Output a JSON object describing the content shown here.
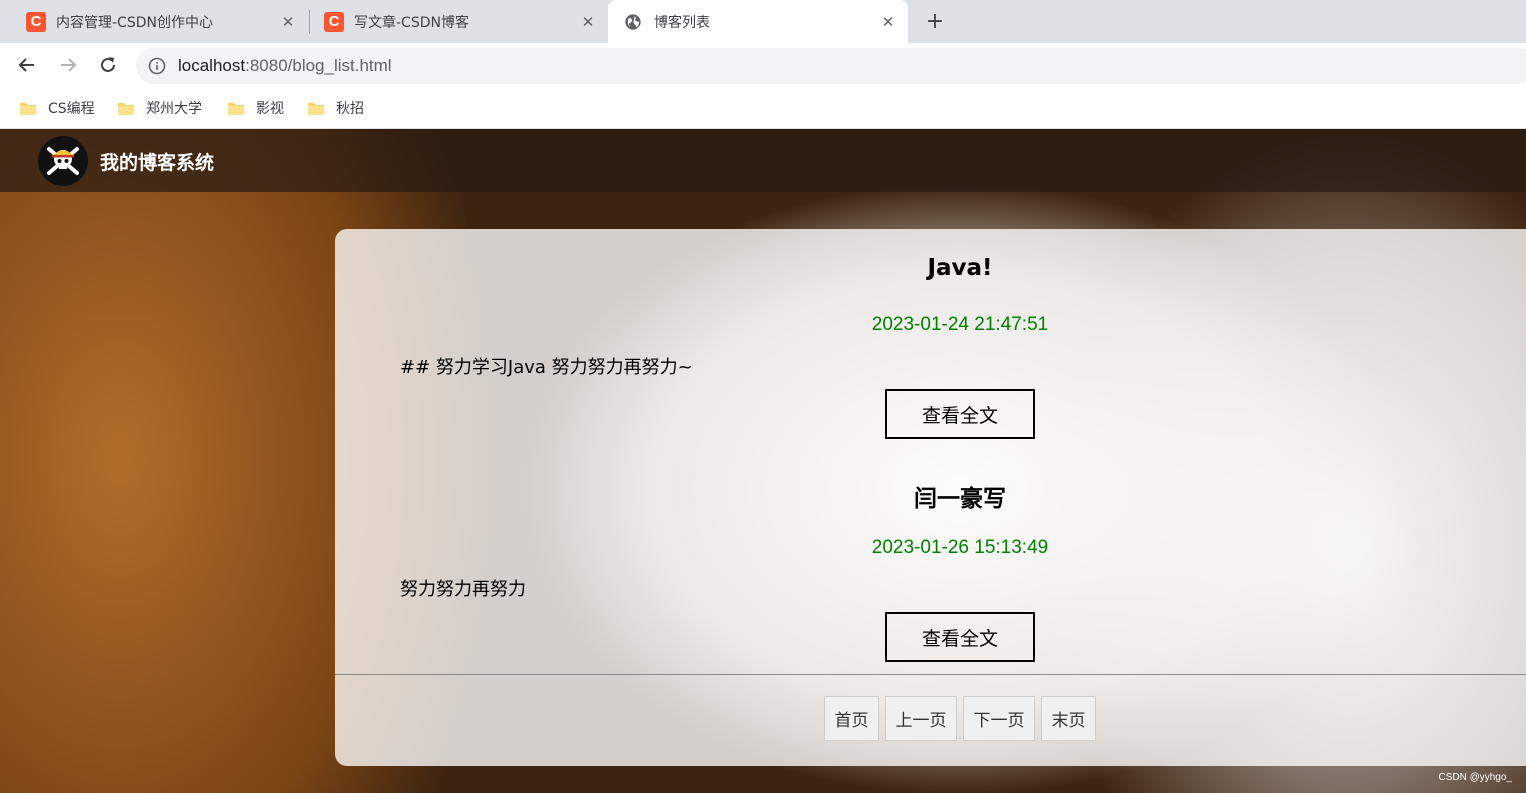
{
  "browser": {
    "tabs": [
      {
        "title": "内容管理-CSDN创作中心",
        "favicon": "csdn-favicon",
        "favicon_letter": "C"
      },
      {
        "title": "写文章-CSDN博客",
        "favicon": "csdn-favicon",
        "favicon_letter": "C"
      },
      {
        "title": "博客列表",
        "favicon": "globe-icon",
        "active": true
      }
    ],
    "url_host": "localhost",
    "url_rest": ":8080/blog_list.html",
    "bookmarks": [
      {
        "label": "CS编程"
      },
      {
        "label": "郑州大学"
      },
      {
        "label": "影视"
      },
      {
        "label": "秋招"
      }
    ]
  },
  "nav": {
    "title": "我的博客系统",
    "logo_icon": "skull-crossbones-icon"
  },
  "blogs": [
    {
      "title": "Java!",
      "date": "2023-01-24 21:47:51",
      "desc": "## 努力学习Java 努力努力再努力~",
      "button": "查看全文"
    },
    {
      "title": "闫一豪写",
      "date": "2023-01-26 15:13:49",
      "desc": "努力努力再努力",
      "button": "查看全文"
    }
  ],
  "pager": {
    "first": "首页",
    "prev": "上一页",
    "next": "下一页",
    "last": "末页"
  },
  "watermark": "CSDN @yyhgo_",
  "colors": {
    "date": "#008000",
    "csdn_brand": "#fc5531",
    "nav_bg": "#281c14"
  }
}
